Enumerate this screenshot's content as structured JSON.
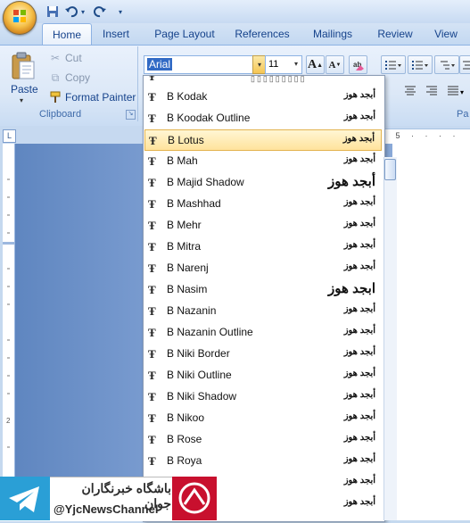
{
  "quick_access": {
    "save_icon": "save-icon",
    "undo_icon": "undo-icon",
    "redo_icon": "redo-icon",
    "customize_icon": "customize-qat-icon"
  },
  "title": "",
  "tabs": [
    "Home",
    "Insert",
    "Page Layout",
    "References",
    "Mailings",
    "Review",
    "View"
  ],
  "clipboard": {
    "group_label": "Clipboard",
    "paste": "Paste",
    "cut": "Cut",
    "copy": "Copy",
    "format_painter": "Format Painter"
  },
  "font": {
    "name_value": "Arial",
    "size_value": "11",
    "grow_label": "A",
    "shrink_label": "A"
  },
  "paragraph": {
    "group_label": "Pa"
  },
  "ruler": {
    "marks": "· 5 · · · ·"
  },
  "font_list": {
    "selected": "B Lotus",
    "items": [
      {
        "name": "B Kodak",
        "sample": "أبجد هوز"
      },
      {
        "name": "B Koodak Outline",
        "sample": "أبجد هوز"
      },
      {
        "name": "B Lotus",
        "sample": "أبجد هوز"
      },
      {
        "name": "B Mah",
        "sample": "أبجد هوز"
      },
      {
        "name": "B Majid Shadow",
        "sample": "أبجد هوز"
      },
      {
        "name": "B Mashhad",
        "sample": "أبجد هوز"
      },
      {
        "name": "B Mehr",
        "sample": "أبجد هوز"
      },
      {
        "name": "B Mitra",
        "sample": "أبجد هوز"
      },
      {
        "name": "B Narenj",
        "sample": "أبجد هوز"
      },
      {
        "name": "B Nasim",
        "sample": "ابجد هوز"
      },
      {
        "name": "B Nazanin",
        "sample": "أبجد هوز"
      },
      {
        "name": "B Nazanin Outline",
        "sample": "أبجد هوز"
      },
      {
        "name": "B Niki Border",
        "sample": "أبجد هوز"
      },
      {
        "name": "B Niki Outline",
        "sample": "أبجد هوز"
      },
      {
        "name": "B Niki Shadow",
        "sample": "أبجد هوز"
      },
      {
        "name": "B Nikoo",
        "sample": "أبجد هوز"
      },
      {
        "name": "B Rose",
        "sample": "أبجد هوز"
      },
      {
        "name": "B Roya",
        "sample": "أبجد هوز"
      },
      {
        "name": "",
        "sample": "أبجد هوز"
      },
      {
        "name": "",
        "sample": "أبجد هوز"
      }
    ]
  },
  "watermark": {
    "line1": "باشگاه خبرنگاران جوان",
    "line2": "@YjcNewsChannel"
  }
}
